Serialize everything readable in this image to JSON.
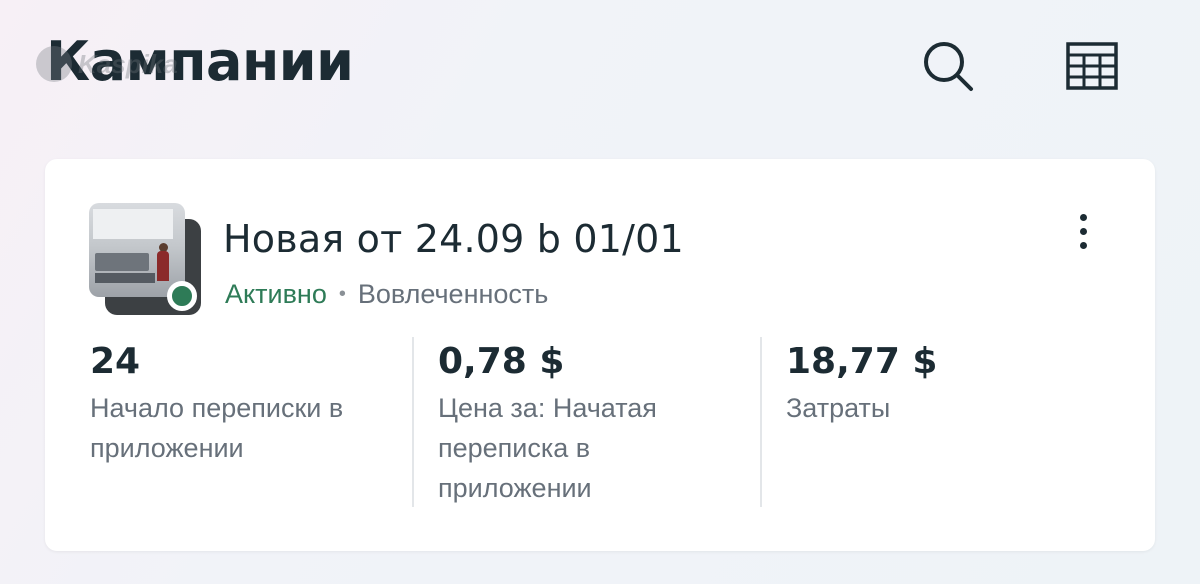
{
  "header": {
    "title": "Кампании",
    "watermark": "Kaspika",
    "icons": {
      "search": "search-icon",
      "table": "table-grid-icon"
    }
  },
  "campaign": {
    "name": "Новая от 24.09 b 01/01",
    "status": "Активно",
    "separator": "•",
    "objective": "Вовлеченность",
    "status_color": "#2e7b57",
    "more_icon": "more-vertical-icon",
    "stats": [
      {
        "value": "24",
        "label": "Начало переписки в приложении"
      },
      {
        "value": "0,78 $",
        "label": "Цена за: Начатая переписка в приложении"
      },
      {
        "value": "18,77 $",
        "label": "Затраты"
      }
    ]
  }
}
